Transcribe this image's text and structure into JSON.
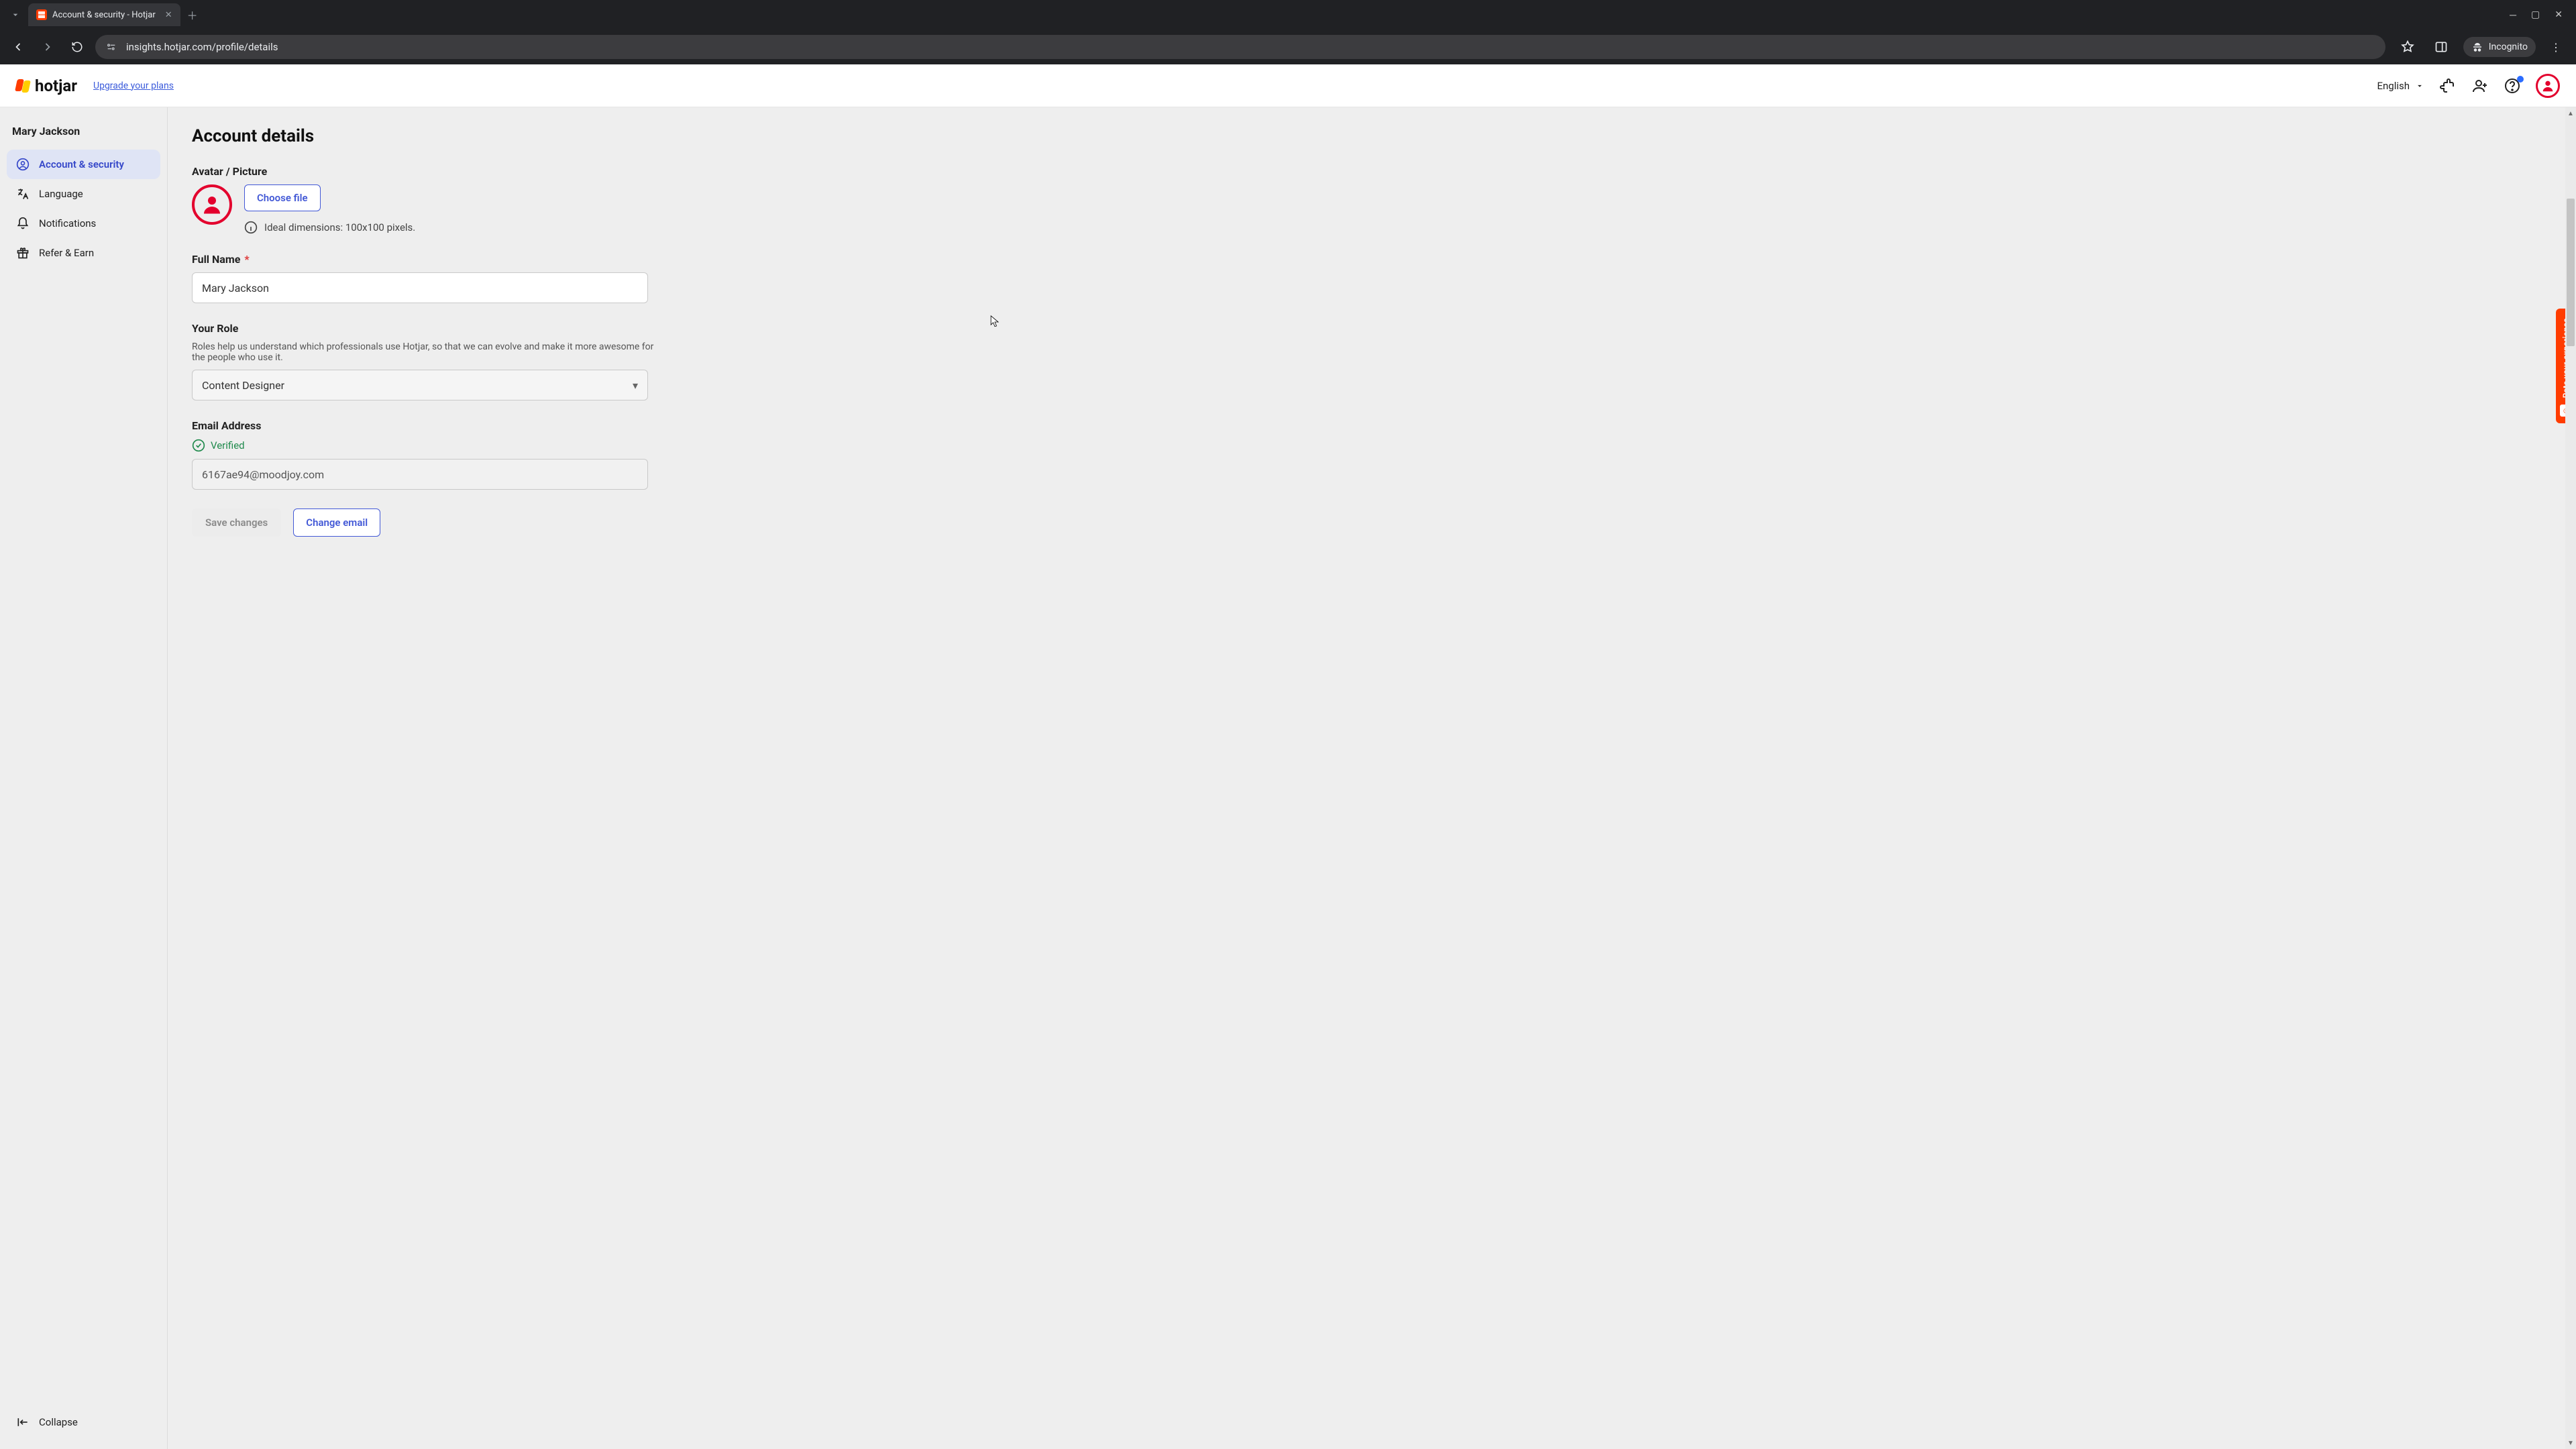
{
  "browser": {
    "tab_title": "Account & security - Hotjar",
    "url": "insights.hotjar.com/profile/details",
    "incognito_label": "Incognito"
  },
  "header": {
    "brand": "hotjar",
    "upgrade": "Upgrade your plans",
    "language": "English"
  },
  "sidebar": {
    "user": "Mary Jackson",
    "items": [
      {
        "label": "Account & security"
      },
      {
        "label": "Language"
      },
      {
        "label": "Notifications"
      },
      {
        "label": "Refer & Earn"
      }
    ],
    "collapse": "Collapse"
  },
  "page": {
    "title": "Account details",
    "avatar_label": "Avatar / Picture",
    "choose_file": "Choose file",
    "avatar_hint": "Ideal dimensions: 100x100 pixels.",
    "full_name_label": "Full Name",
    "full_name_value": "Mary Jackson",
    "role_label": "Your Role",
    "role_sub": "Roles help us understand which professionals use Hotjar, so that we can evolve and make it more awesome for the people who use it.",
    "role_value": "Content Designer",
    "email_label": "Email Address",
    "verified": "Verified",
    "email_value": "6167ae94@moodjoy.com",
    "save": "Save changes",
    "change_email": "Change email"
  },
  "feedback": {
    "label": "Rate your experience"
  }
}
